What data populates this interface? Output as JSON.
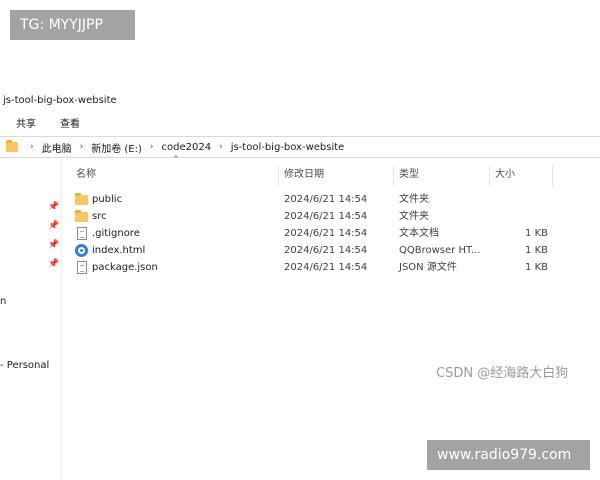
{
  "watermarks": {
    "top_left": "TG: MYYJJPP",
    "bottom_right": "www.radio979.com",
    "csdn": "CSDN @经海路大白狗"
  },
  "window": {
    "title": "js-tool-big-box-website"
  },
  "ribbon": {
    "tabs": [
      "共享",
      "查看"
    ]
  },
  "address": {
    "crumbs": [
      "此电脑",
      "新加卷 (E:)",
      "code2024",
      "js-tool-big-box-website"
    ]
  },
  "sidebar": {
    "fragments": [
      "n",
      "- Personal"
    ]
  },
  "columns": {
    "name": "名称",
    "date": "修改日期",
    "type": "类型",
    "size": "大小"
  },
  "files": [
    {
      "icon": "folder-icon",
      "name": "public",
      "date": "2024/6/21 14:54",
      "type": "文件夹",
      "size": ""
    },
    {
      "icon": "folder-icon",
      "name": "src",
      "date": "2024/6/21 14:54",
      "type": "文件夹",
      "size": ""
    },
    {
      "icon": "text-file-icon",
      "name": ".gitignore",
      "date": "2024/6/21 14:54",
      "type": "文本文档",
      "size": "1 KB"
    },
    {
      "icon": "browser-html-icon",
      "name": "index.html",
      "date": "2024/6/21 14:54",
      "type": "QQBrowser HT...",
      "size": "1 KB"
    },
    {
      "icon": "json-file-icon",
      "name": "package.json",
      "date": "2024/6/21 14:54",
      "type": "JSON 源文件",
      "size": "1 KB"
    }
  ]
}
